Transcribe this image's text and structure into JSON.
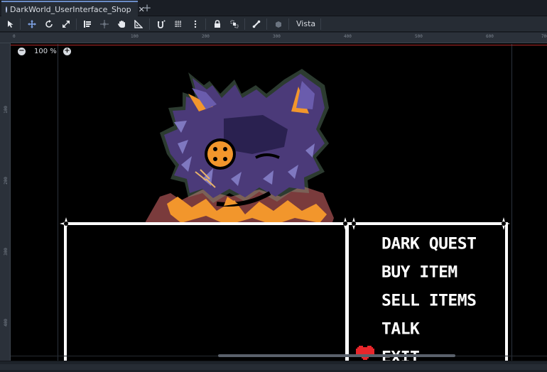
{
  "tabs": [
    {
      "label": "DarkWorld_UserInterface_Shop",
      "close": "✕"
    }
  ],
  "add_tab": "+",
  "toolbar": {
    "tools": [
      "select-icon",
      "move-icon",
      "rotate-icon",
      "scale-icon",
      "list-select-icon",
      "pivot-icon",
      "pan-icon",
      "ruler-icon",
      "snap-icon",
      "grid-snap-icon",
      "more-icon",
      "lock-icon",
      "group-icon",
      "bone-icon",
      "camera-icon"
    ],
    "view_menu": "Vista"
  },
  "viewport": {
    "zoom_out": "−",
    "zoom": "100 %",
    "zoom_in": "+",
    "ruler_top": [
      "0",
      "100",
      "200",
      "300",
      "400",
      "500",
      "600",
      "700"
    ],
    "ruler_left": [
      "100",
      "200",
      "300",
      "400"
    ]
  },
  "shop_menu": {
    "items": [
      "DARK QUEST",
      "BUY ITEM",
      "SELL ITEMS",
      "TALK",
      "EXIT"
    ]
  },
  "colors": {
    "accent": "#6b8cc7",
    "soul": "#e8262b",
    "character_purple": "#4b3a79",
    "character_orange": "#f2962c"
  }
}
